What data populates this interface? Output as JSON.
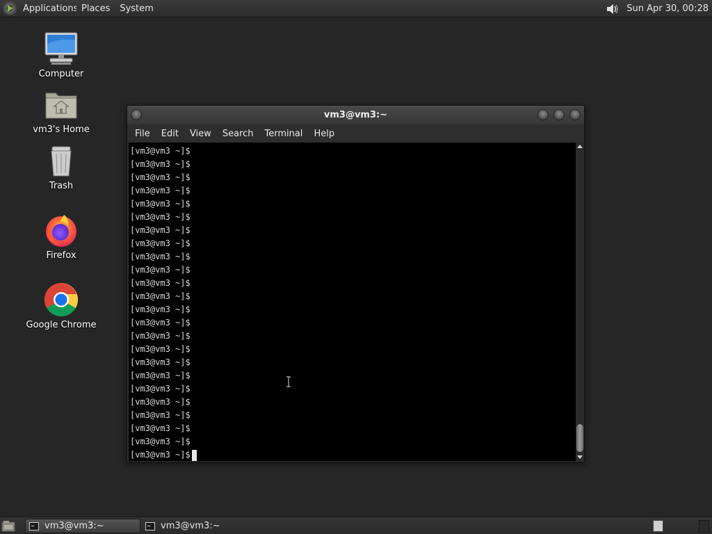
{
  "top_panel": {
    "menu": [
      "Applications",
      "Places",
      "System"
    ],
    "clock": "Sun Apr 30, 00:28"
  },
  "desktop": {
    "icons": [
      {
        "label": "Computer",
        "icon": "computer-icon"
      },
      {
        "label": "vm3's Home",
        "icon": "home-folder-icon"
      },
      {
        "label": "Trash",
        "icon": "trash-icon"
      },
      {
        "label": "Firefox",
        "icon": "firefox-icon"
      },
      {
        "label": "Google Chrome",
        "icon": "chrome-icon"
      }
    ]
  },
  "terminal": {
    "title": "vm3@vm3:~",
    "menu": [
      "File",
      "Edit",
      "View",
      "Search",
      "Terminal",
      "Help"
    ],
    "prompt": "[vm3@vm3 ~]$",
    "line_count": 24
  },
  "taskbar": {
    "tasks": [
      {
        "label": "vm3@vm3:~",
        "active": true
      },
      {
        "label": "vm3@vm3:~",
        "active": false
      }
    ],
    "workspaces": 2
  },
  "colors": {
    "desktop_bg": "#262626",
    "terminal_bg": "#000000",
    "firefox_orange": "#ff7139",
    "chrome_blue": "#1a73e8"
  }
}
